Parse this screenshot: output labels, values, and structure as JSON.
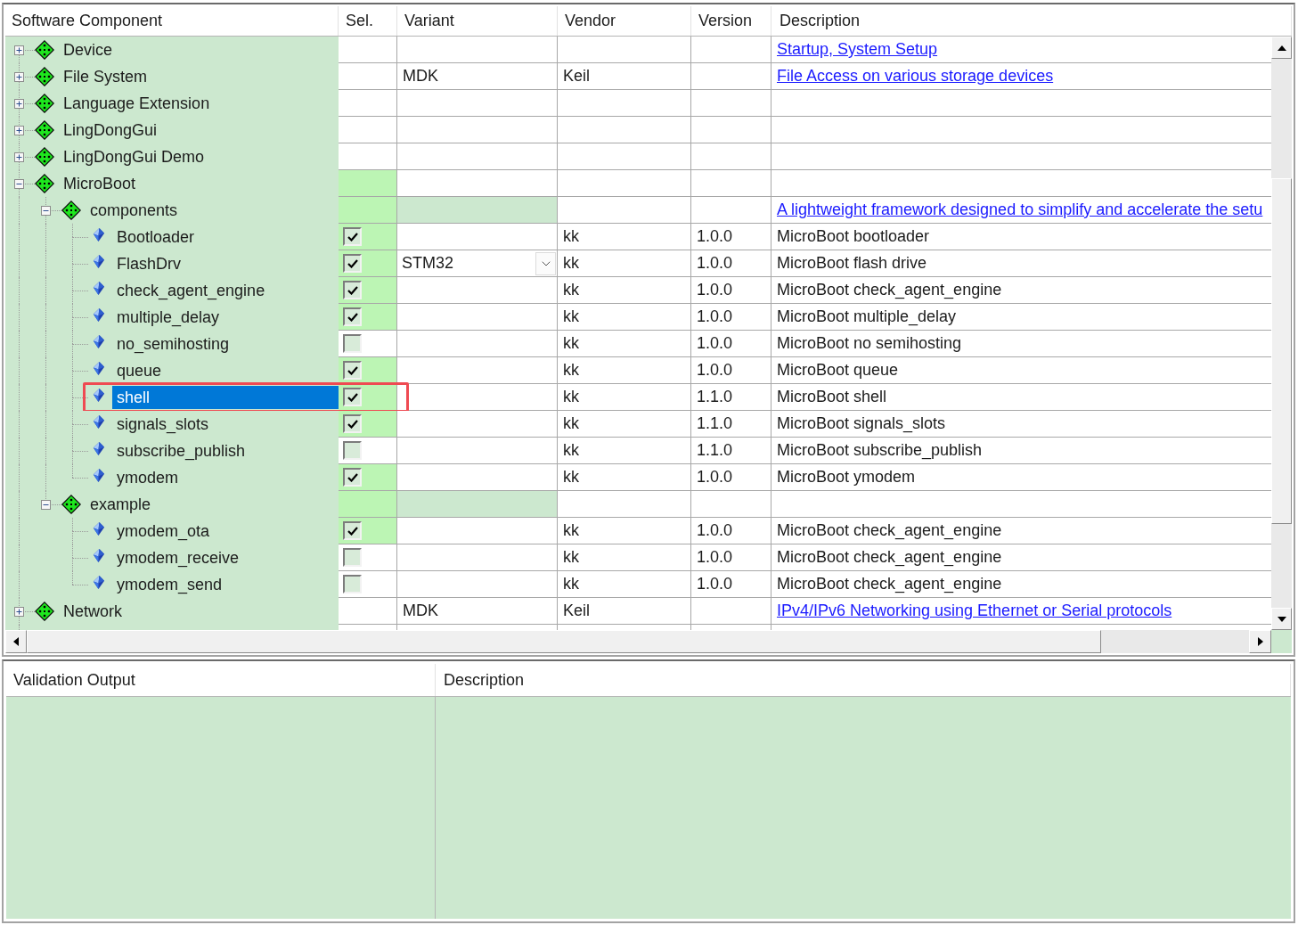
{
  "component_table": {
    "columns": [
      "Software Component",
      "Sel.",
      "Variant",
      "Vendor",
      "Version",
      "Description"
    ],
    "rows": [
      {
        "kind": "class",
        "name": "Device",
        "expanded": false,
        "active": false,
        "selected": false,
        "highlighted": false,
        "description": "Startup, System Setup",
        "description_link": true
      },
      {
        "kind": "class",
        "name": "File System",
        "expanded": false,
        "active": false,
        "selected": false,
        "highlighted": false,
        "variant": "MDK",
        "variant_dropdown": false,
        "vendor": "Keil",
        "description": "File Access on various storage devices",
        "description_link": true
      },
      {
        "kind": "class",
        "name": "Language Extension",
        "expanded": false,
        "active": false,
        "selected": false,
        "highlighted": false
      },
      {
        "kind": "class",
        "name": "LingDongGui",
        "expanded": false,
        "active": false,
        "selected": false,
        "highlighted": false
      },
      {
        "kind": "class",
        "name": "LingDongGui Demo",
        "expanded": false,
        "active": false,
        "selected": false,
        "highlighted": false
      },
      {
        "kind": "class",
        "name": "MicroBoot",
        "expanded": true,
        "active": true,
        "selected": false,
        "highlighted": false,
        "children": [
          {
            "kind": "group",
            "name": "components",
            "expanded": true,
            "active": true,
            "selected": false,
            "highlighted": false,
            "description": "A lightweight framework designed to simplify and accelerate the setu",
            "description_link": true,
            "children": [
              {
                "kind": "component",
                "name": "Bootloader",
                "checked": true,
                "selected": false,
                "highlighted": false,
                "vendor": "kk",
                "version": "1.0.0",
                "description": "MicroBoot bootloader",
                "description_link": false
              },
              {
                "kind": "component",
                "name": "FlashDrv",
                "checked": true,
                "selected": false,
                "highlighted": false,
                "variant": "STM32",
                "variant_dropdown": true,
                "vendor": "kk",
                "version": "1.0.0",
                "description": "MicroBoot flash drive",
                "description_link": false
              },
              {
                "kind": "component",
                "name": "check_agent_engine",
                "checked": true,
                "selected": false,
                "highlighted": false,
                "vendor": "kk",
                "version": "1.0.0",
                "description": "MicroBoot check_agent_engine",
                "description_link": false
              },
              {
                "kind": "component",
                "name": "multiple_delay",
                "checked": true,
                "selected": false,
                "highlighted": false,
                "vendor": "kk",
                "version": "1.0.0",
                "description": "MicroBoot multiple_delay",
                "description_link": false
              },
              {
                "kind": "component",
                "name": "no_semihosting",
                "checked": false,
                "selected": false,
                "highlighted": false,
                "vendor": "kk",
                "version": "1.0.0",
                "description": "MicroBoot no semihosting",
                "description_link": false
              },
              {
                "kind": "component",
                "name": "queue",
                "checked": true,
                "selected": false,
                "highlighted": false,
                "vendor": "kk",
                "version": "1.0.0",
                "description": "MicroBoot queue",
                "description_link": false
              },
              {
                "kind": "component",
                "name": "shell",
                "checked": true,
                "selected": true,
                "highlighted": true,
                "vendor": "kk",
                "version": "1.1.0",
                "description": "MicroBoot shell",
                "description_link": false
              },
              {
                "kind": "component",
                "name": "signals_slots",
                "checked": true,
                "selected": false,
                "highlighted": false,
                "vendor": "kk",
                "version": "1.1.0",
                "description": "MicroBoot signals_slots",
                "description_link": false
              },
              {
                "kind": "component",
                "name": "subscribe_publish",
                "checked": false,
                "selected": false,
                "highlighted": false,
                "vendor": "kk",
                "version": "1.1.0",
                "description": "MicroBoot subscribe_publish",
                "description_link": false
              },
              {
                "kind": "component",
                "name": "ymodem",
                "checked": true,
                "selected": false,
                "highlighted": false,
                "vendor": "kk",
                "version": "1.0.0",
                "description": "MicroBoot ymodem",
                "description_link": false
              }
            ]
          },
          {
            "kind": "group",
            "name": "example",
            "expanded": true,
            "active": true,
            "selected": false,
            "highlighted": false,
            "children": [
              {
                "kind": "component",
                "name": "ymodem_ota",
                "checked": true,
                "selected": false,
                "highlighted": false,
                "vendor": "kk",
                "version": "1.0.0",
                "description": "MicroBoot check_agent_engine",
                "description_link": false
              },
              {
                "kind": "component",
                "name": "ymodem_receive",
                "checked": false,
                "selected": false,
                "highlighted": false,
                "vendor": "kk",
                "version": "1.0.0",
                "description": "MicroBoot check_agent_engine",
                "description_link": false
              },
              {
                "kind": "component",
                "name": "ymodem_send",
                "checked": false,
                "selected": false,
                "highlighted": false,
                "vendor": "kk",
                "version": "1.0.0",
                "description": "MicroBoot check_agent_engine",
                "description_link": false
              }
            ]
          }
        ]
      },
      {
        "kind": "class",
        "name": "Network",
        "expanded": false,
        "active": false,
        "selected": false,
        "highlighted": false,
        "variant": "MDK",
        "variant_dropdown": false,
        "vendor": "Keil",
        "description": "IPv4/IPv6 Networking using Ethernet or Serial protocols",
        "description_link": true
      }
    ]
  },
  "validation_table": {
    "columns": [
      "Validation Output",
      "Description"
    ]
  }
}
